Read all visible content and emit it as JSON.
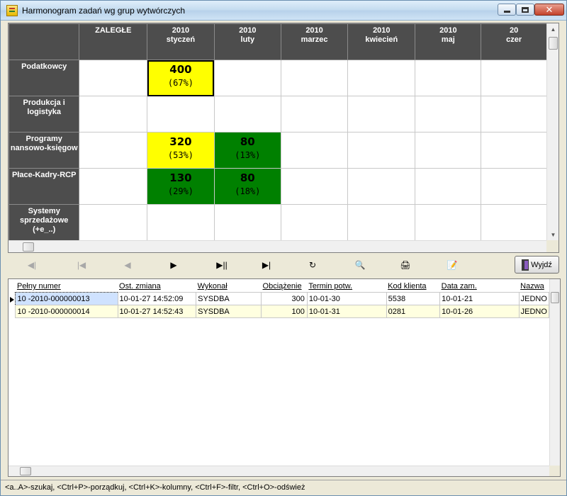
{
  "window": {
    "title": "Harmonogram zadań wg grup wytwórczych",
    "close_glyph": "✕"
  },
  "schedule": {
    "columns": [
      {
        "line1": "ZALEGŁE",
        "line2": ""
      },
      {
        "line1": "2010",
        "line2": "styczeń"
      },
      {
        "line1": "2010",
        "line2": "luty"
      },
      {
        "line1": "2010",
        "line2": "marzec"
      },
      {
        "line1": "2010",
        "line2": "kwiecień"
      },
      {
        "line1": "2010",
        "line2": "maj"
      },
      {
        "line1": "20",
        "line2": "czer"
      }
    ],
    "rows": [
      {
        "label": "Podatkowcy",
        "cells": {
          "1": {
            "value": "400",
            "pct": "(67%)",
            "color": "yellow",
            "selected": true
          }
        }
      },
      {
        "label": "Produkcja  i\nlogistyka",
        "cells": {}
      },
      {
        "label": "Programy\nnansowo-księgow",
        "cells": {
          "1": {
            "value": "320",
            "pct": "(53%)",
            "color": "yellow"
          },
          "2": {
            "value": "80",
            "pct": "(13%)",
            "color": "green"
          }
        }
      },
      {
        "label": "Płace-Kadry-RCP",
        "cells": {
          "1": {
            "value": "130",
            "pct": "(29%)",
            "color": "green"
          },
          "2": {
            "value": "80",
            "pct": "(18%)",
            "color": "green"
          }
        }
      },
      {
        "label": "Systemy\nsprzedażowe\n(+e_..)",
        "cells": {}
      }
    ],
    "colors": {
      "yellow": "#ffff00",
      "green": "#008000",
      "header_bg": "#4d4d4d"
    }
  },
  "toolbar": {
    "buttons": [
      {
        "name": "first-record-button",
        "glyph": "◀|",
        "icon": "first-icon",
        "enabled": false
      },
      {
        "name": "prev-page-button",
        "glyph": "|◀",
        "icon": "prev-page-icon",
        "enabled": false
      },
      {
        "name": "prev-record-button",
        "glyph": "◀",
        "icon": "prev-icon",
        "enabled": false
      },
      {
        "name": "next-record-button",
        "glyph": "▶",
        "icon": "next-icon",
        "enabled": true
      },
      {
        "name": "next-page-button",
        "glyph": "▶||",
        "icon": "next-page-icon",
        "enabled": true
      },
      {
        "name": "last-record-button",
        "glyph": "▶|",
        "icon": "last-icon",
        "enabled": true
      },
      {
        "name": "refresh-button",
        "glyph": "↻",
        "icon": "refresh-icon",
        "enabled": true
      },
      {
        "name": "search-button",
        "glyph": "🔍",
        "icon": "binoculars-icon",
        "enabled": true
      },
      {
        "name": "print-button",
        "glyph": "🖨",
        "icon": "printer-icon",
        "enabled": true
      },
      {
        "name": "report-button",
        "glyph": "📝",
        "icon": "report-icon",
        "enabled": true
      }
    ],
    "exit_label": "Wyjdź"
  },
  "list": {
    "columns": [
      "Pełny numer",
      "Ost. zmiana",
      "Wykonał",
      "Obciążenie",
      "Termin potw.",
      "Kod klienta",
      "Data zam.",
      "Nazwa"
    ],
    "rows": [
      [
        "10 -2010-000000013",
        "10-01-27 14:52:09",
        "SYSDBA",
        "300",
        "10-01-30",
        "5538",
        "10-01-21",
        "JEDNO"
      ],
      [
        "10 -2010-000000014",
        "10-01-27 14:52:43",
        "SYSDBA",
        "100",
        "10-01-31",
        "0281",
        "10-01-26",
        "JEDNO"
      ]
    ]
  },
  "status": {
    "text": "<a..A>-szukaj,  <Ctrl+P>-porządkuj,  <Ctrl+K>-kolumny,  <Ctrl+F>-filtr,  <Ctrl+O>-odśwież"
  }
}
